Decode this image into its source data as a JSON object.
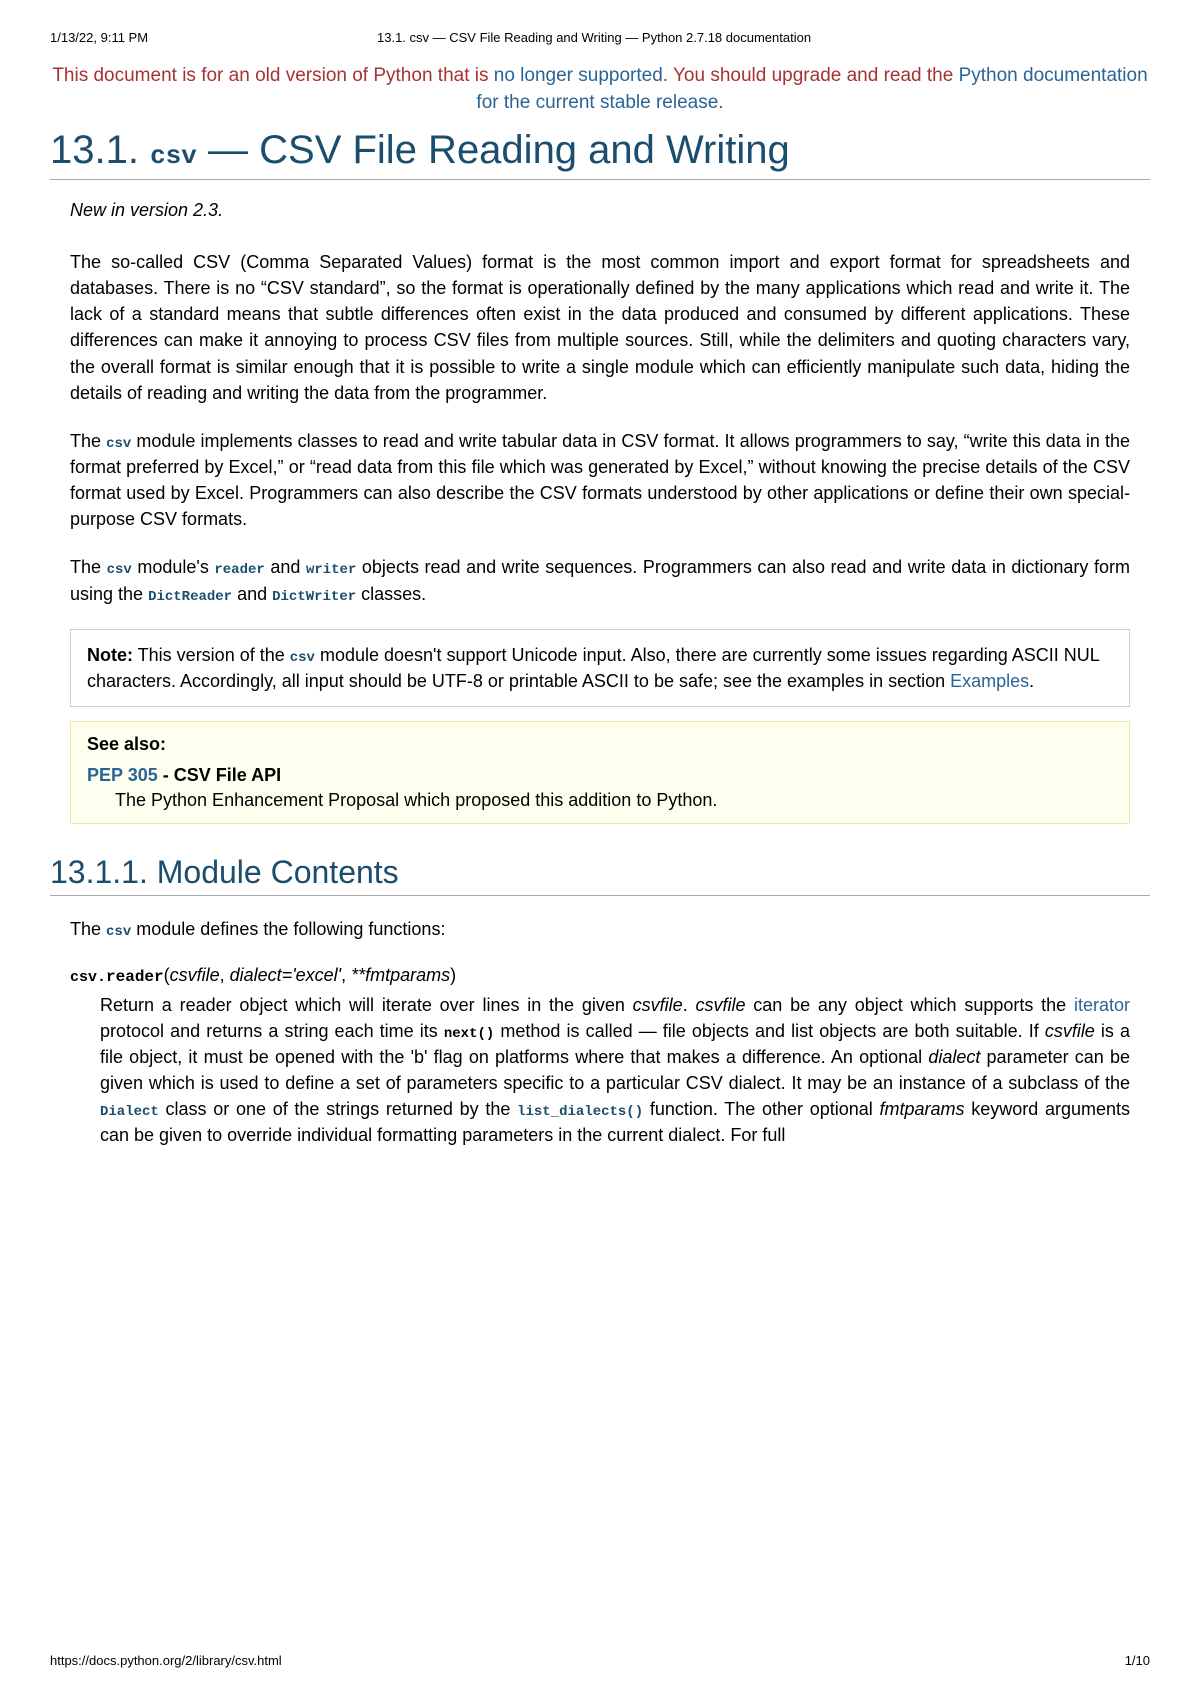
{
  "print": {
    "datetime": "1/13/22, 9:11 PM",
    "doc_title": "13.1. csv — CSV File Reading and Writing — Python 2.7.18 documentation",
    "url": "https://docs.python.org/2/library/csv.html",
    "page_num": "1/10"
  },
  "banner": {
    "prefix": "This document is for an old version of Python that is ",
    "link1": "no longer supported",
    "mid": ". You should upgrade and read the ",
    "link2": "Python documentation for the current stable release",
    "suffix": "."
  },
  "title": {
    "num": "13.1. ",
    "code": "csv",
    "dash": " — ",
    "rest": "CSV File Reading and Writing"
  },
  "versionadded": "New in version 2.3.",
  "p1": "The so-called CSV (Comma Separated Values) format is the most common import and export format for spreadsheets and databases. There is no “CSV standard”, so the format is operationally defined by the many applications which read and write it. The lack of a standard means that subtle differences often exist in the data produced and consumed by different applications. These differences can make it annoying to process CSV files from multiple sources. Still, while the delimiters and quoting characters vary, the overall format is similar enough that it is possible to write a single module which can efficiently manipulate such data, hiding the details of reading and writing the data from the programmer.",
  "p2": {
    "a": "The ",
    "csv": "csv",
    "b": " module implements classes to read and write tabular data in CSV format. It allows programmers to say, “write this data in the format preferred by Excel,” or “read data from this file which was generated by Excel,” without knowing the precise details of the CSV format used by Excel. Programmers can also describe the CSV formats understood by other applications or define their own special-purpose CSV formats."
  },
  "p3": {
    "a": "The ",
    "csv": "csv",
    "b": " module's ",
    "reader": "reader",
    "c": " and ",
    "writer": "writer",
    "d": " objects read and write sequences. Programmers can also read and write data in dictionary form using the ",
    "dictreader": "DictReader",
    "e": " and ",
    "dictwriter": "DictWriter",
    "f": " classes."
  },
  "note": {
    "label": "Note:",
    "a": "   This version of the ",
    "csv": "csv",
    "b": " module doesn't support Unicode input. Also, there are currently some issues regarding ASCII NUL characters. Accordingly, all input should be UTF-8 or printable ASCII to be safe; see the examples in section ",
    "examples_link": "Examples",
    "c": "."
  },
  "seealso": {
    "label": "See also:",
    "pep": "PEP 305",
    "pep_title": " - CSV File API",
    "pep_desc": "The Python Enhancement Proposal which proposed this addition to Python."
  },
  "section1": "13.1.1. Module Contents",
  "p4": {
    "a": "The ",
    "csv": "csv",
    "b": " module defines the following functions:"
  },
  "func": {
    "mod": "csv.",
    "name": "reader",
    "open": "(",
    "p_csvfile": "csvfile",
    "c1": ", ",
    "p_dialect": "dialect='excel'",
    "c2": ", ",
    "p_fmt": "**fmtparams",
    "close": ")",
    "desc": {
      "a": "Return a reader object which will iterate over lines in the given ",
      "csvfile1": "csvfile",
      "b": ". ",
      "csvfile2": "csvfile",
      "c": " can be any object which supports the ",
      "iterator": "iterator",
      "d": " protocol and returns a string each time its ",
      "next": "next()",
      "e": " method is called — file objects and list objects are both suitable. If ",
      "csvfile3": "csvfile",
      "f": " is a file object, it must be opened with the 'b' flag on platforms where that makes a difference. An optional ",
      "dialect1": "dialect",
      "g": " parameter can be given which is used to define a set of parameters specific to a particular CSV dialect. It may be an instance of a subclass of the ",
      "Dialect": "Dialect",
      "h": " class or one of the strings returned by the ",
      "listdialects": "list_dialects()",
      "i": " function. The other optional ",
      "fmtparams": "fmtparams",
      "j": " keyword arguments can be given to override individual formatting parameters in the current dialect. For full"
    }
  }
}
